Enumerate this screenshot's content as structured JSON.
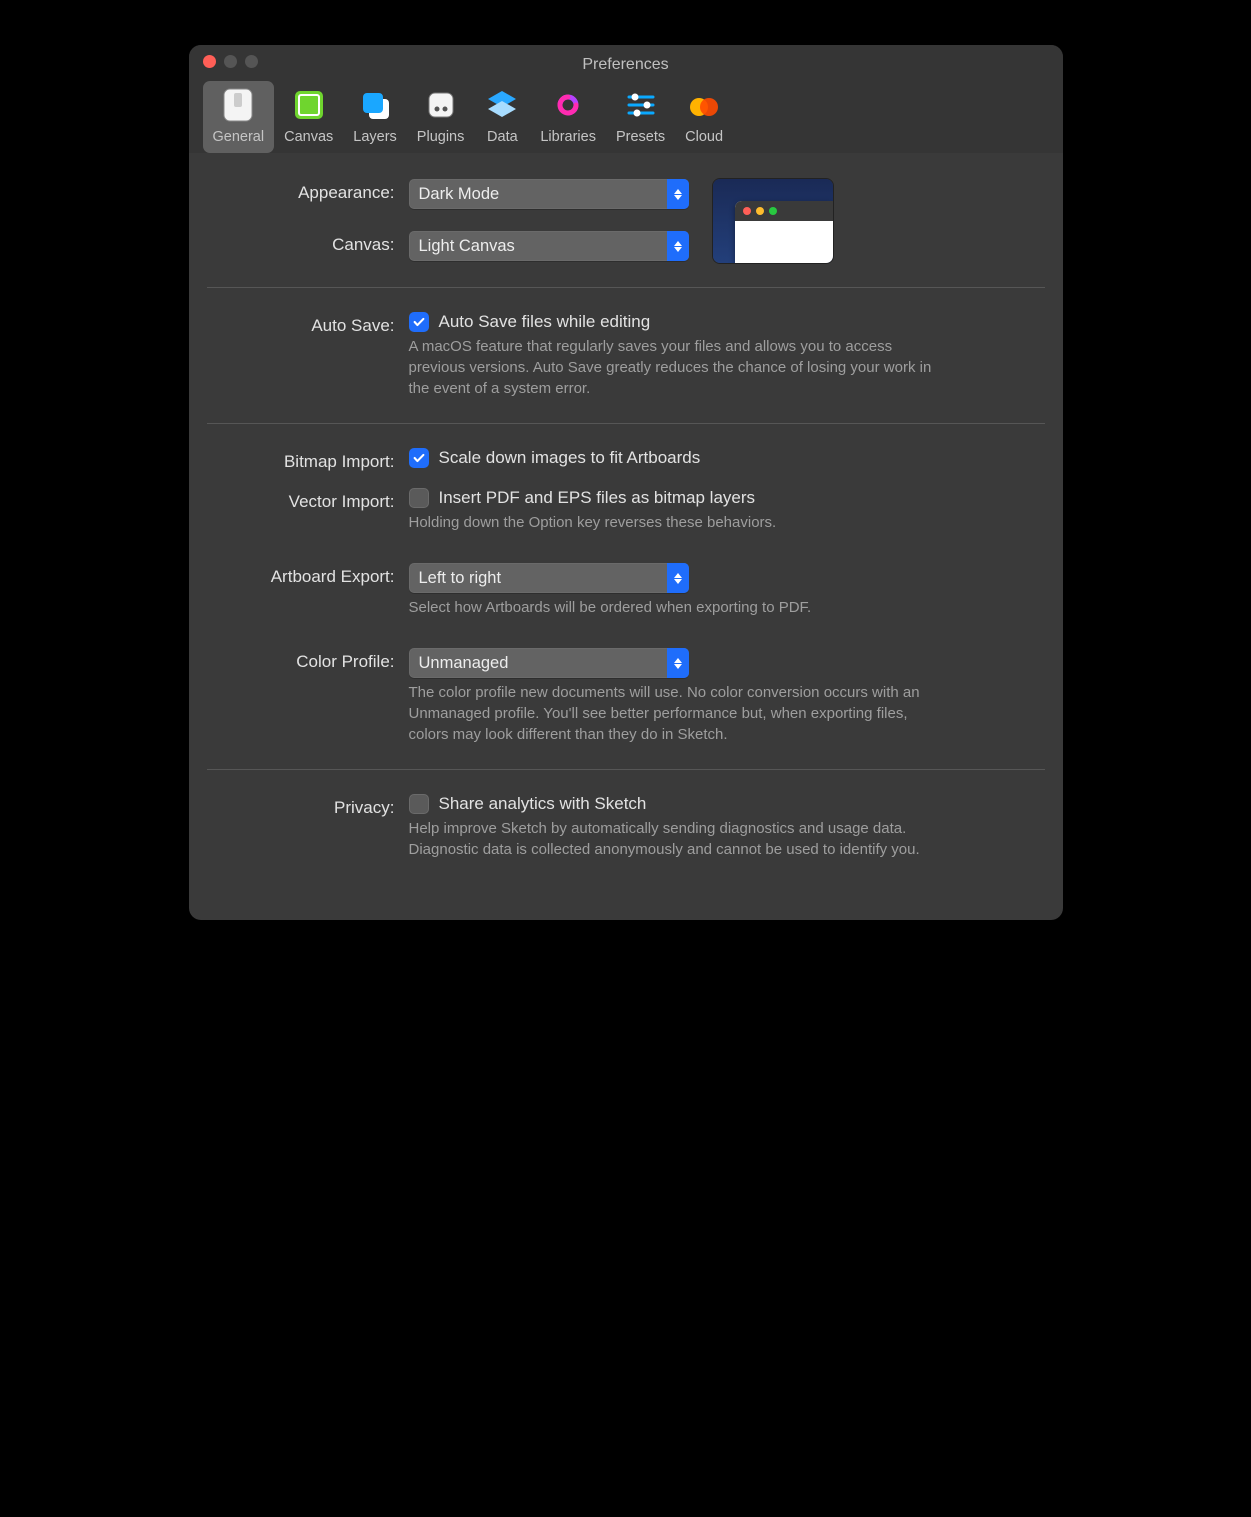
{
  "window_title": "Preferences",
  "tabs": {
    "general": "General",
    "canvas": "Canvas",
    "layers": "Layers",
    "plugins": "Plugins",
    "data": "Data",
    "libraries": "Libraries",
    "presets": "Presets",
    "cloud": "Cloud"
  },
  "labels": {
    "appearance": "Appearance:",
    "canvas": "Canvas:",
    "auto_save": "Auto Save:",
    "bitmap_import": "Bitmap Import:",
    "vector_import": "Vector Import:",
    "artboard_export": "Artboard Export:",
    "color_profile": "Color Profile:",
    "privacy": "Privacy:"
  },
  "values": {
    "appearance": "Dark Mode",
    "canvas": "Light Canvas",
    "artboard_export": "Left to right",
    "color_profile": "Unmanaged"
  },
  "checkbox_labels": {
    "auto_save": "Auto Save files while editing",
    "bitmap_import": "Scale down images to fit Artboards",
    "vector_import": "Insert PDF and EPS files as bitmap layers",
    "privacy": "Share analytics with Sketch"
  },
  "checkbox_state": {
    "auto_save": true,
    "bitmap_import": true,
    "vector_import": false,
    "privacy": false
  },
  "hints": {
    "auto_save": "A macOS feature that regularly saves your files and allows you to access previous versions. Auto Save greatly reduces the chance of losing your work in the event of a system error.",
    "import": "Holding down the Option key reverses these behaviors.",
    "artboard_export": "Select how Artboards will be ordered when exporting to PDF.",
    "color_profile": "The color profile new documents will use. No color conversion occurs with an Unmanaged profile. You'll see better performance but, when exporting files, colors may look different than they do in Sketch.",
    "privacy": "Help improve Sketch by automatically sending diagnostics and usage data. Diagnostic data is collected anonymously and cannot be used to identify you."
  }
}
